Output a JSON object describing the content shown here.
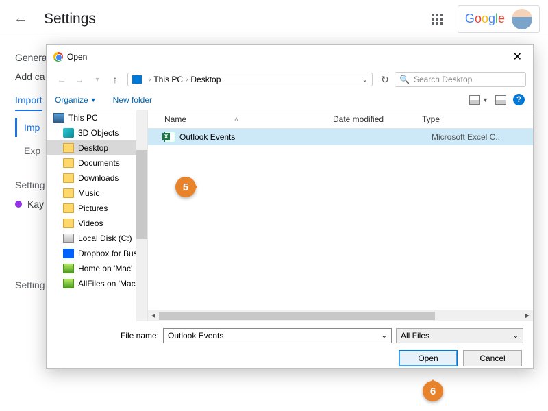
{
  "topbar": {
    "title": "Settings",
    "brand": "Google"
  },
  "sidebar": {
    "general": "Genera",
    "addcal": "Add ca",
    "tab_import": "Import",
    "sub_import": "Imp",
    "sub_export": "Exp",
    "section_settings": "Setting",
    "kay": "Kay",
    "section_settings2": "Setting"
  },
  "dialog": {
    "title": "Open",
    "path": {
      "root": "This PC",
      "current": "Desktop"
    },
    "search_placeholder": "Search Desktop",
    "toolbar": {
      "organize": "Organize",
      "newfolder": "New folder"
    },
    "columns": {
      "name": "Name",
      "date": "Date modified",
      "type": "Type"
    },
    "tree": [
      {
        "label": "This PC",
        "icon": "pc"
      },
      {
        "label": "3D Objects",
        "icon": "3d"
      },
      {
        "label": "Desktop",
        "icon": "folder",
        "selected": true
      },
      {
        "label": "Documents",
        "icon": "folder"
      },
      {
        "label": "Downloads",
        "icon": "folder"
      },
      {
        "label": "Music",
        "icon": "folder"
      },
      {
        "label": "Pictures",
        "icon": "folder"
      },
      {
        "label": "Videos",
        "icon": "folder"
      },
      {
        "label": "Local Disk (C:)",
        "icon": "disk"
      },
      {
        "label": "Dropbox for Bus",
        "icon": "dbox"
      },
      {
        "label": "Home on 'Mac'",
        "icon": "mac"
      },
      {
        "label": "AllFiles on 'Mac'",
        "icon": "mac"
      }
    ],
    "files": [
      {
        "name": "Outlook Events",
        "type": "Microsoft Excel C..",
        "selected": true
      }
    ],
    "filename_label": "File name:",
    "filename_value": "Outlook Events",
    "filter": "All Files",
    "buttons": {
      "open": "Open",
      "cancel": "Cancel"
    }
  },
  "callouts": {
    "c5": "5",
    "c6": "6"
  }
}
